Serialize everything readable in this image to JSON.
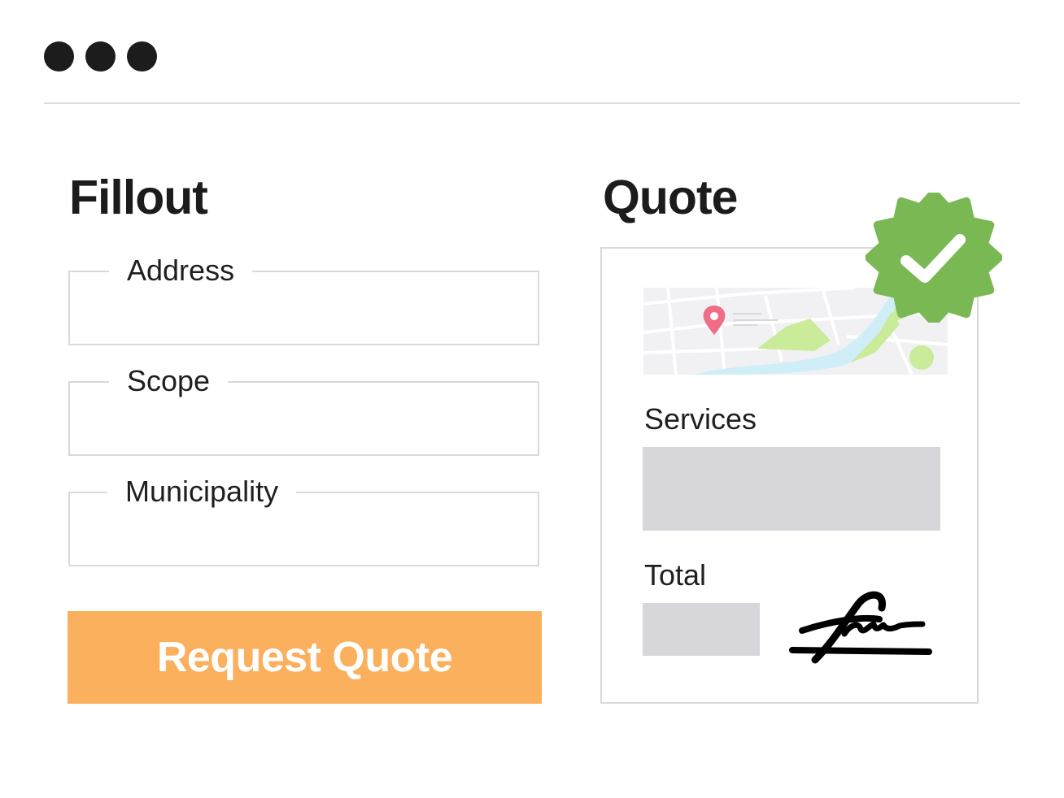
{
  "window": {
    "controls": [
      "dot",
      "dot",
      "dot"
    ]
  },
  "fillout": {
    "title": "Fillout",
    "fields": [
      {
        "label": "Address",
        "value": "",
        "placeholder": ""
      },
      {
        "label": "Scope",
        "value": "",
        "placeholder": ""
      },
      {
        "label": "Municipality",
        "value": "",
        "placeholder": ""
      }
    ],
    "submit_label": "Request Quote",
    "submit_color": "#fbb05e"
  },
  "quote": {
    "title": "Quote",
    "map_icon": "location-pin-icon",
    "services_label": "Services",
    "total_label": "Total",
    "approved_icon": "verified-badge-icon",
    "approved_color": "#7ab854",
    "signature_icon": "signature-icon"
  }
}
